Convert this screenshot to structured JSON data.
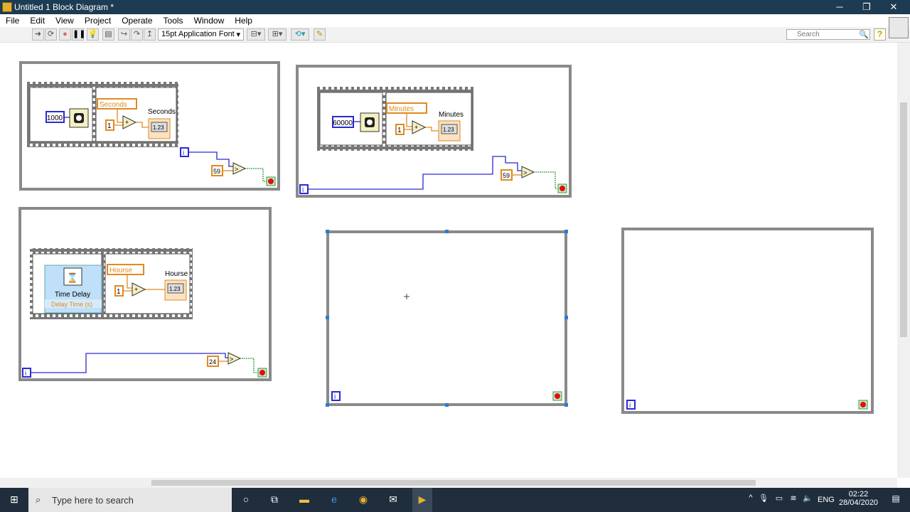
{
  "window": {
    "title": "Untitled 1 Block Diagram *",
    "minimize": "─",
    "maximize": "❐",
    "close": "✕"
  },
  "menu": [
    "File",
    "Edit",
    "View",
    "Project",
    "Operate",
    "Tools",
    "Window",
    "Help"
  ],
  "toolbar": {
    "font": "15pt Application Font",
    "search_placeholder": "Search",
    "help": "?"
  },
  "loops": [
    {
      "wait_ms": "1000",
      "local_var": "Seconds",
      "increment": "1",
      "indicator_label": "Seconds",
      "indicator": "1.23",
      "compare_const": "59",
      "compare_op": ">",
      "iter": "i"
    },
    {
      "wait_ms": "60000",
      "local_var": "Minutes",
      "increment": "1",
      "indicator_label": "Minutes",
      "indicator": "1.23",
      "compare_const": "59",
      "compare_op": ">",
      "iter": "i"
    },
    {
      "express_vi": "Time Delay",
      "express_input": "Delay Time (s)",
      "local_var": "Hourse",
      "increment": "1",
      "indicator_label": "Hourse",
      "indicator": "1.23",
      "compare_const": "24",
      "compare_op": ">",
      "iter": "i"
    },
    {
      "iter": "i"
    },
    {
      "iter": "i"
    }
  ],
  "taskbar": {
    "search_placeholder": "Type here to search",
    "language": "ENG",
    "time": "02:22",
    "date": "28/04/2020"
  },
  "colors": {
    "titlebar": "#1d3b52",
    "wire_int": "#2a2ad0",
    "wire_dbl": "#e08a20",
    "wire_bool": "#3a9a3a",
    "loop_border": "#8a8a8a"
  }
}
